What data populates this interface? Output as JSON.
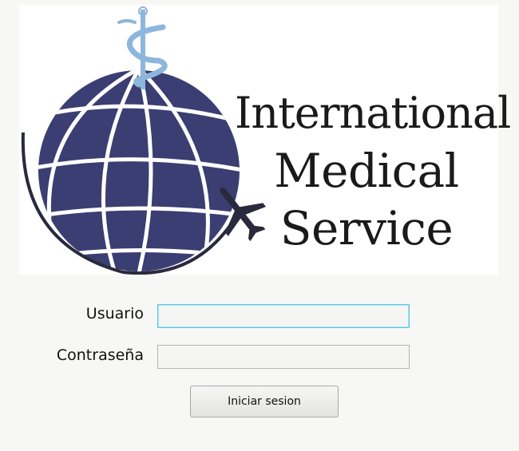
{
  "brand": {
    "line1": "International",
    "line2": "Medical",
    "line3": "Service"
  },
  "form": {
    "user_label": "Usuario",
    "user_value": "",
    "password_label": "Contraseña",
    "password_value": "",
    "submit_label": "Iniciar sesion"
  },
  "colors": {
    "globe": "#3b3e72",
    "caduceus": "#8db6dd",
    "airplane": "#2a2a3e",
    "focus_border": "#5cc7ea"
  },
  "icons": {
    "logo": "globe-with-caduceus-and-airplane"
  }
}
